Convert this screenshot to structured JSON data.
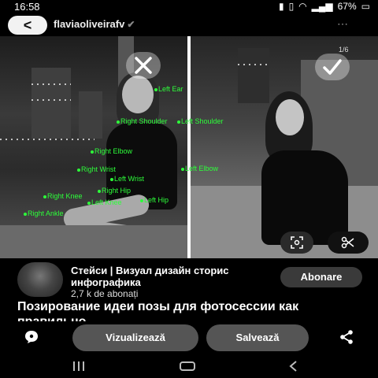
{
  "status_bar": {
    "time": "16:58",
    "battery": "67%"
  },
  "header": {
    "back_label": "<",
    "username": "flaviaoliveirafv",
    "verified_glyph": "✔"
  },
  "image": {
    "counter": "1/6",
    "keypoints": [
      "Left Ear",
      "Right Shoulder",
      "Left Shoulder",
      "Right Elbow",
      "Right Wrist",
      "Left Wrist",
      "Left Elbow",
      "Right Hip",
      "Right Knee",
      "Left Knee",
      "Left Hip",
      "Right Ankle"
    ]
  },
  "creator": {
    "name": "Стейси | Визуал дизайн сторис инфографика",
    "subscribers": "2,7 k de abonați",
    "subscribe_label": "Abonare"
  },
  "pin": {
    "title": "Позирование идеи позы для фотосессии как правильно"
  },
  "actions": {
    "view_label": "Vizualizează",
    "save_label": "Salvează"
  },
  "colors": {
    "keypoint": "#2dff3a",
    "background": "#000000",
    "button": "#555555"
  }
}
